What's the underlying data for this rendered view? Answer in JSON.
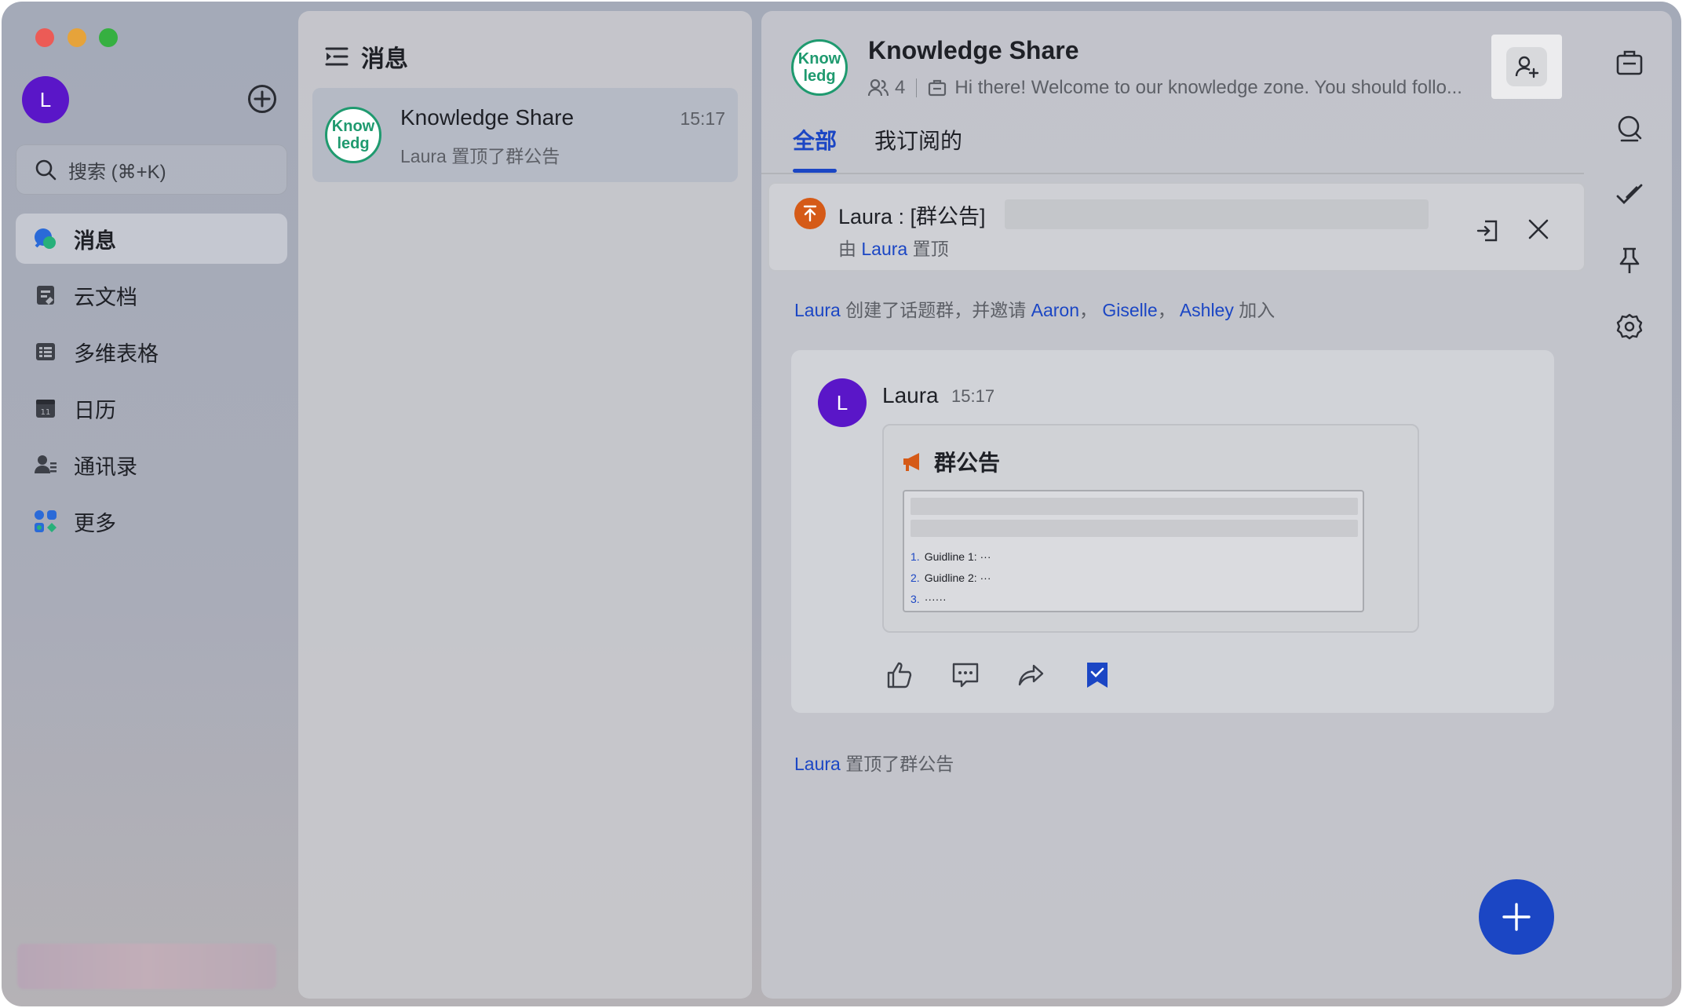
{
  "window": {
    "traffic_lights": [
      "close",
      "minimize",
      "zoom"
    ]
  },
  "sidebar": {
    "avatar_initial": "L",
    "search_placeholder": "搜索 (⌘+K)",
    "items": [
      {
        "label": "消息",
        "icon": "chat-bubbles-icon",
        "active": true
      },
      {
        "label": "云文档",
        "icon": "cloud-doc-icon",
        "active": false
      },
      {
        "label": "多维表格",
        "icon": "table-icon",
        "active": false
      },
      {
        "label": "日历",
        "icon": "calendar-icon",
        "active": false
      },
      {
        "label": "通讯录",
        "icon": "contacts-icon",
        "active": false
      },
      {
        "label": "更多",
        "icon": "more-apps-icon",
        "active": false
      }
    ]
  },
  "list": {
    "header": "消息",
    "conversations": [
      {
        "avatar_text": "Know ledg",
        "title": "Knowledge Share",
        "time": "15:17",
        "preview": "Laura 置顶了群公告"
      }
    ]
  },
  "chat": {
    "avatar_text": "Know ledg",
    "title": "Knowledge Share",
    "member_count": "4",
    "description": "Hi there! Welcome to our knowledge zone. You should follo...",
    "tabs": [
      {
        "label": "全部",
        "active": true
      },
      {
        "label": "我订阅的",
        "active": false
      }
    ],
    "pinned": {
      "title": "Laura : [群公告]",
      "by_prefix": "由",
      "by_user": "Laura",
      "by_suffix": "置顶"
    },
    "system_created": {
      "user": "Laura",
      "text": "创建了话题群，并邀请",
      "invitees": [
        "Aaron",
        "Giselle",
        "Ashley"
      ],
      "sep": "，",
      "suffix": "加入"
    },
    "message": {
      "avatar_initial": "L",
      "sender": "Laura",
      "time": "15:17",
      "card_title": "群公告",
      "preview_items": [
        {
          "n": "1.",
          "text": "Guidline 1: ···"
        },
        {
          "n": "2.",
          "text": "Guidline 2: ···"
        },
        {
          "n": "3.",
          "text": "······"
        }
      ]
    },
    "system_pinned": {
      "user": "Laura",
      "text": "置顶了群公告"
    }
  },
  "colors": {
    "accent": "#1b46c4",
    "avatar_purple": "#5a16c8",
    "group_green": "#1f9a6f",
    "pin_orange": "#d55a17"
  }
}
